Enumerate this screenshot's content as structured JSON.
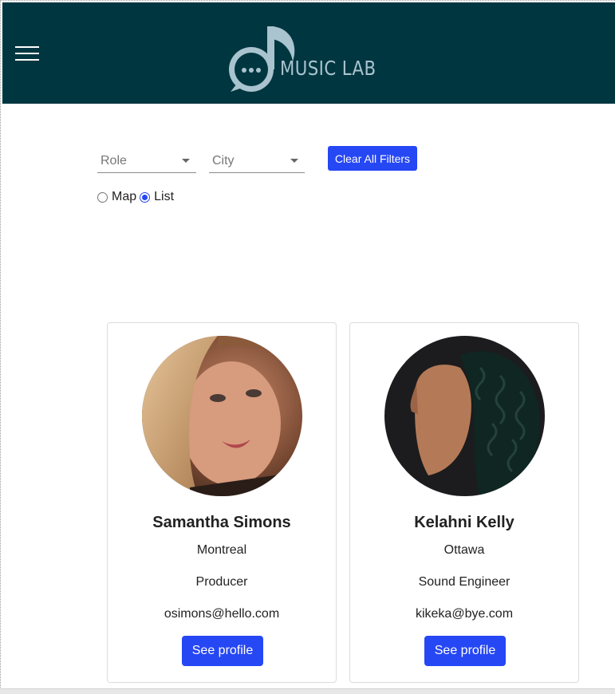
{
  "header": {
    "menu_icon": "hamburger-menu-icon",
    "logo_icon": "music-note-chat-icon",
    "logo_text": "MUSIC LAB",
    "background_color": "#003640",
    "logo_color": "#a9c4cf"
  },
  "filters": {
    "role_placeholder": "Role",
    "city_placeholder": "City",
    "clear_label": "Clear All Filters",
    "view_options": [
      {
        "label": "Map",
        "selected": false
      },
      {
        "label": "List",
        "selected": true
      }
    ]
  },
  "accent_color": "#2647f4",
  "profiles": [
    {
      "name": "Samantha Simons",
      "city": "Montreal",
      "role": "Producer",
      "email": "osimons@hello.com",
      "button_label": "See profile",
      "avatar": "woman-portrait-photo"
    },
    {
      "name": "Kelahni Kelly",
      "city": "Ottawa",
      "role": "Sound Engineer",
      "email": "kikeka@bye.com",
      "button_label": "See profile",
      "avatar": "woman-profile-curly-hair-photo"
    }
  ]
}
